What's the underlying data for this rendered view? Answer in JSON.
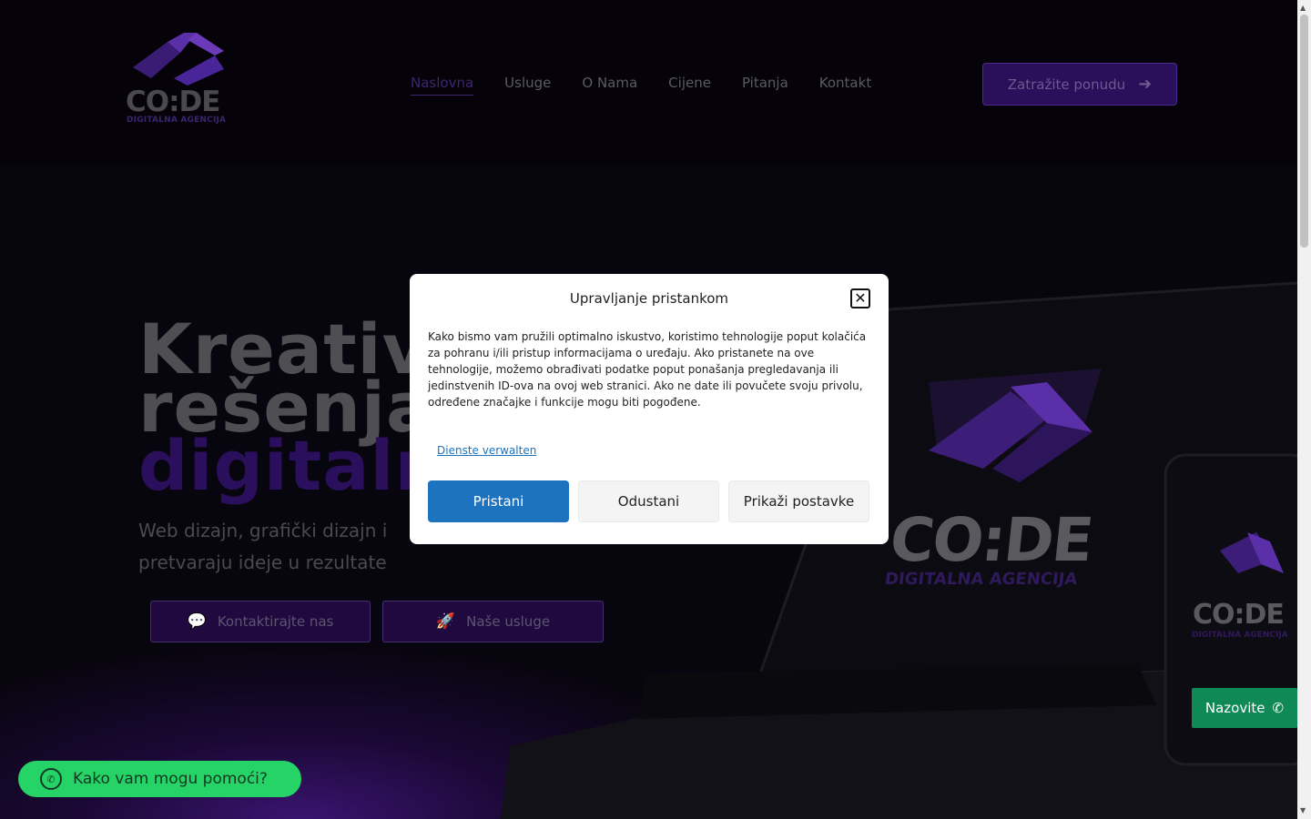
{
  "header": {
    "logo_text": "CO:DE",
    "logo_subtitle": "DIGITALNA AGENCIJA",
    "nav": [
      {
        "label": "Naslovna"
      },
      {
        "label": "Usluge"
      },
      {
        "label": "O Nama"
      },
      {
        "label": "Cijene"
      },
      {
        "label": "Pitanja"
      },
      {
        "label": "Kontakt"
      }
    ],
    "cta_label": "Zatražite ponudu"
  },
  "hero": {
    "title_line1": "Kreativ",
    "title_line2": "rešenja",
    "title_line3": "digitaln",
    "subtitle_line1": "Web dizajn, grafički dizajn i",
    "subtitle_line2": "pretvaraju ideje u rezultate",
    "button_contact": "Kontaktirajte nas",
    "button_services": "Naše usluge"
  },
  "device": {
    "logo_text": "CO:DE",
    "logo_subtitle": "DIGITALNA AGENCIJA"
  },
  "consent": {
    "title": "Upravljanje pristankom",
    "body": "Kako bismo vam pružili optimalno iskustvo, koristimo tehnologije poput kolačića za pohranu i/ili pristup informacijama o uređaju. Ako pristanete na ove tehnologije, možemo obrađivati podatke poput ponašanja pregledavanja ili jedinstvenih ID-ova na ovoj web stranici. Ako ne date ili povučete svoju privolu, određene značajke i funkcije mogu biti pogođene.",
    "manage_link": "Dienste verwalten",
    "accept": "Pristani",
    "deny": "Odustani",
    "preferences": "Prikaži postavke"
  },
  "floating": {
    "call_label": "Nazovite",
    "whatsapp_label": "Kako vam mogu pomoći?"
  },
  "colors": {
    "accent_blue": "#1e73be",
    "whatsapp_green": "#25d366",
    "call_green": "#0f8a57",
    "brand_purple": "#2a0f5a"
  }
}
